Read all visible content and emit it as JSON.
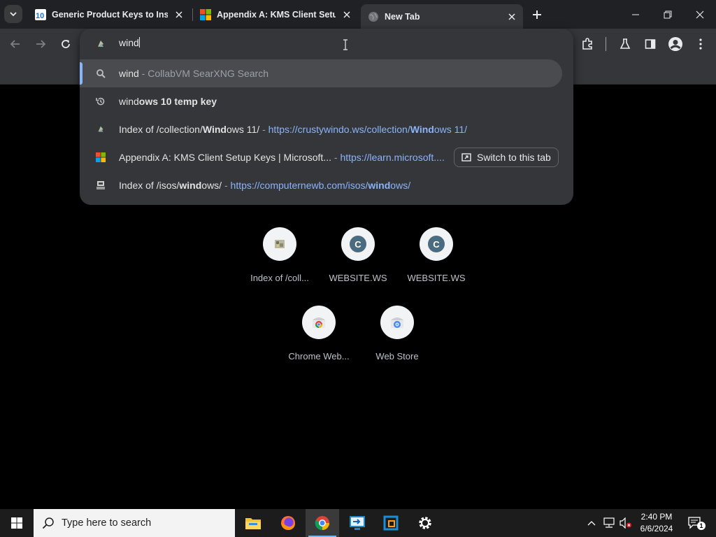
{
  "tabs": [
    {
      "title": "Generic Product Keys to Install",
      "favicon": "windows10-favicon"
    },
    {
      "title": "Appendix A: KMS Client Setup",
      "favicon": "microsoft-favicon"
    },
    {
      "title": "New Tab",
      "favicon": "chrome-globe-favicon"
    }
  ],
  "omnibox": {
    "input_value": "wind",
    "suggestions": [
      {
        "typed": "wind",
        "dim": " - CollabVM SearXNG Search"
      },
      {
        "prefix": "wind",
        "bold": "ows 10 temp key"
      },
      {
        "title_a": "Index of /collection/",
        "title_b": "Win",
        "title_c": "d",
        "title_d": "ows 11/",
        "sep": " - ",
        "url_a": "https://crustywindo.ws/collection/",
        "url_b": "Wind",
        "url_c": "ows 11/"
      },
      {
        "title": "Appendix A: KMS Client Setup Keys | Microsoft...",
        "sep": " - ",
        "url": "https://learn.microsoft....",
        "action": "Switch to this tab"
      },
      {
        "title_a": "Index of /isos/",
        "title_b": "wind",
        "title_c": "ows/",
        "sep": " - ",
        "url_a": "https://computernewb.com/isos/",
        "url_b": "wind",
        "url_c": "ows/"
      }
    ]
  },
  "shortcuts": [
    {
      "label": "Index of /coll...",
      "badge": ""
    },
    {
      "label": "WEBSITE.WS",
      "badge": "C"
    },
    {
      "label": "WEBSITE.WS",
      "badge": "C"
    },
    {
      "label": "Chrome Web...",
      "badge": ""
    },
    {
      "label": "Web Store",
      "badge": ""
    }
  ],
  "taskbar": {
    "search_placeholder": "Type here to search",
    "time": "2:40 PM",
    "date": "6/6/2024",
    "notification_count": "1"
  },
  "colors": {
    "accent": "#8ab4f8",
    "tab_strip": "#202124",
    "toolbar": "#35363a"
  }
}
